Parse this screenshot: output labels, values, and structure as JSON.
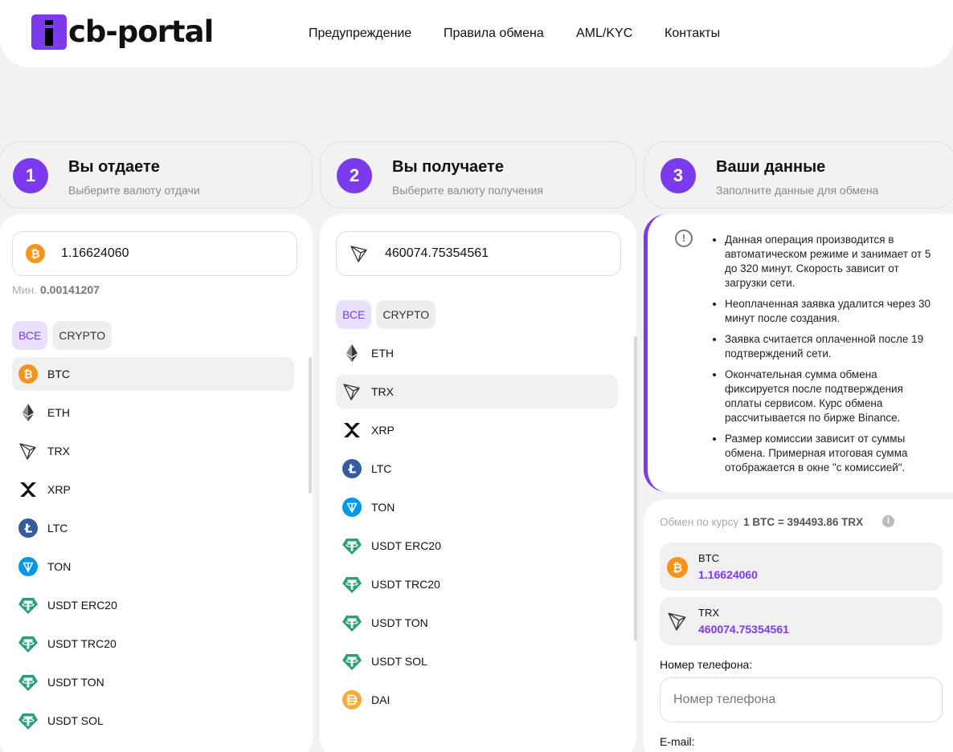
{
  "header": {
    "logo_text": "cb-portal",
    "nav": [
      {
        "label": "Предупреждение"
      },
      {
        "label": "Правила обмена"
      },
      {
        "label": "AML/KYC"
      },
      {
        "label": "Контакты"
      }
    ]
  },
  "steps": [
    {
      "num": "1",
      "title": "Вы отдаете",
      "subtitle": "Выберите валюту отдачи"
    },
    {
      "num": "2",
      "title": "Вы получаете",
      "subtitle": "Выберите валюту получения"
    },
    {
      "num": "3",
      "title": "Ваши данные",
      "subtitle": "Заполните данные для обмена"
    }
  ],
  "give": {
    "amount": "1.16624060",
    "min_label": "Мин.",
    "min_value": "0.00141207",
    "filters": [
      "ВСЕ",
      "CRYPTO"
    ],
    "coins": [
      "BTC",
      "ETH",
      "TRX",
      "XRP",
      "LTC",
      "TON",
      "USDT ERC20",
      "USDT TRC20",
      "USDT TON",
      "USDT SOL"
    ],
    "selected": "BTC"
  },
  "receive": {
    "amount": "460074.75354561",
    "filters": [
      "ВСЕ",
      "CRYPTO"
    ],
    "coins": [
      "ETH",
      "TRX",
      "XRP",
      "LTC",
      "TON",
      "USDT ERC20",
      "USDT TRC20",
      "USDT TON",
      "USDT SOL",
      "DAI"
    ],
    "selected": "TRX"
  },
  "info": {
    "items": [
      "Данная операция производится в автоматическом режиме и занимает от 5 до 320 минут. Скорость зависит от загрузки сети.",
      "Неоплаченная заявка удалится через 30 минут после создания.",
      "Заявка считается оплаченной после 19 подтверждений сети.",
      "Окончательная сумма обмена фиксируется после подтверждения оплаты сервисом. Курс обмена рассчитывается по бирже Binance.",
      "Размер комиссии зависит от суммы обмена. Примерная итоговая сумма отображается в окне \"с комиссией\"."
    ]
  },
  "summary": {
    "rate_label": "Обмен по курсу",
    "rate_value": "1 BTC = 394493.86 TRX",
    "give_coin": "BTC",
    "give_amount": "1.16624060",
    "get_coin": "TRX",
    "get_amount": "460074.75354561",
    "phone_label": "Номер телефона:",
    "phone_placeholder": "Номер телефона",
    "email_label": "E-mail:"
  },
  "colors": {
    "accent": "#7c3aed",
    "btc": "#f7931a",
    "ltc": "#345d9d",
    "ton": "#0098ea",
    "usdt": "#26a17b",
    "dai": "#f5ac37"
  }
}
